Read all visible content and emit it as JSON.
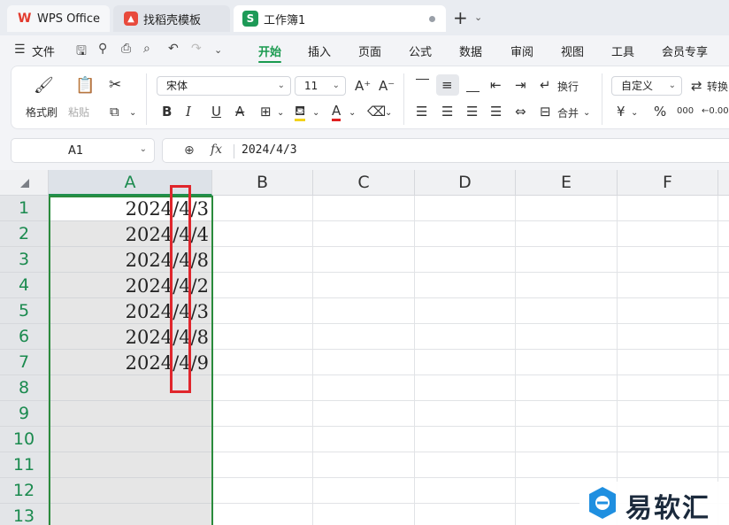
{
  "tabs": {
    "wps": {
      "label": "WPS Office"
    },
    "find": {
      "label": "找稻壳模板"
    },
    "work": {
      "label": "工作簿1"
    }
  },
  "menu": {
    "file": "文件",
    "tabs": [
      "开始",
      "插入",
      "页面",
      "公式",
      "数据",
      "审阅",
      "视图",
      "工具",
      "会员专享"
    ],
    "active_tab": "开始"
  },
  "ribbon": {
    "format_painter": "格式刷",
    "paste": "粘贴",
    "font_name": "宋体",
    "font_size": "11",
    "wrap": "换行",
    "merge": "合并",
    "number_format": "自定义",
    "convert": "转换",
    "bold": "B",
    "italic": "I",
    "underline": "U",
    "strike": "A",
    "percent": "%",
    "thousands": "000",
    "decimal": "←0.00",
    "currency": "¥"
  },
  "formula_bar": {
    "name_box": "A1",
    "fx": "fx",
    "value": "2024/4/3"
  },
  "grid": {
    "columns": [
      "A",
      "B",
      "C",
      "D",
      "E",
      "F"
    ],
    "rows": [
      "1",
      "2",
      "3",
      "4",
      "5",
      "6",
      "7",
      "8",
      "9",
      "10",
      "11",
      "12",
      "13"
    ],
    "col_a_values": [
      "2024/4/3",
      "2024/4/4",
      "2024/4/8",
      "2024/4/2",
      "2024/4/3",
      "2024/4/8",
      "2024/4/9",
      "",
      "",
      "",
      "",
      "",
      ""
    ]
  },
  "colors": {
    "accent": "#1a9a4f",
    "selection": "#2a8b3c",
    "highlight_box": "#e0262c"
  },
  "watermark": {
    "text": "易软汇"
  }
}
